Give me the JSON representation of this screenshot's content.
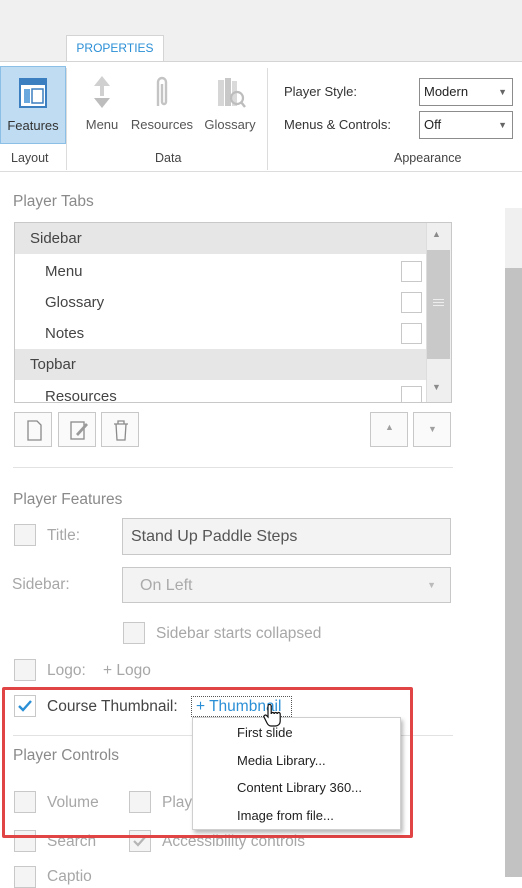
{
  "ribbon": {
    "tab": "PROPERTIES",
    "buttons": {
      "features": "Features",
      "menu": "Menu",
      "resources": "Resources",
      "glossary": "Glossary"
    },
    "groups": {
      "layout": "Layout",
      "data": "Data",
      "appearance": "Appearance"
    },
    "player_style": {
      "label": "Player Style:",
      "value": "Modern"
    },
    "menus_controls": {
      "label": "Menus & Controls:",
      "value": "Off"
    }
  },
  "player_tabs": {
    "title": "Player Tabs",
    "rows": [
      {
        "label": "Sidebar",
        "header": true
      },
      {
        "label": "Menu"
      },
      {
        "label": "Glossary"
      },
      {
        "label": "Notes"
      },
      {
        "label": "Topbar",
        "header": true
      },
      {
        "label": "Resources"
      }
    ]
  },
  "player_features": {
    "title": "Player Features",
    "title_field": {
      "label": "Title:",
      "value": "Stand Up Paddle Steps"
    },
    "sidebar": {
      "label": "Sidebar:",
      "value": "On Left"
    },
    "sidebar_collapsed": "Sidebar starts collapsed",
    "logo": {
      "label": "Logo:",
      "link": "+ Logo"
    },
    "course_thumbnail": {
      "label": "Course Thumbnail:",
      "link": "+ Thumbnail",
      "checked": true
    }
  },
  "thumbnail_menu": [
    "First slide",
    "Media Library...",
    "Content Library 360...",
    "Image from file..."
  ],
  "player_controls": {
    "title": "Player Controls",
    "volume": "Volume",
    "play": "Play",
    "search": "Search",
    "accessibility": "Accessibility controls",
    "captions": "Captio"
  },
  "colors": {
    "accent": "#2b8fd6",
    "highlight": "#e04444",
    "selected": "#bfdcf2"
  }
}
